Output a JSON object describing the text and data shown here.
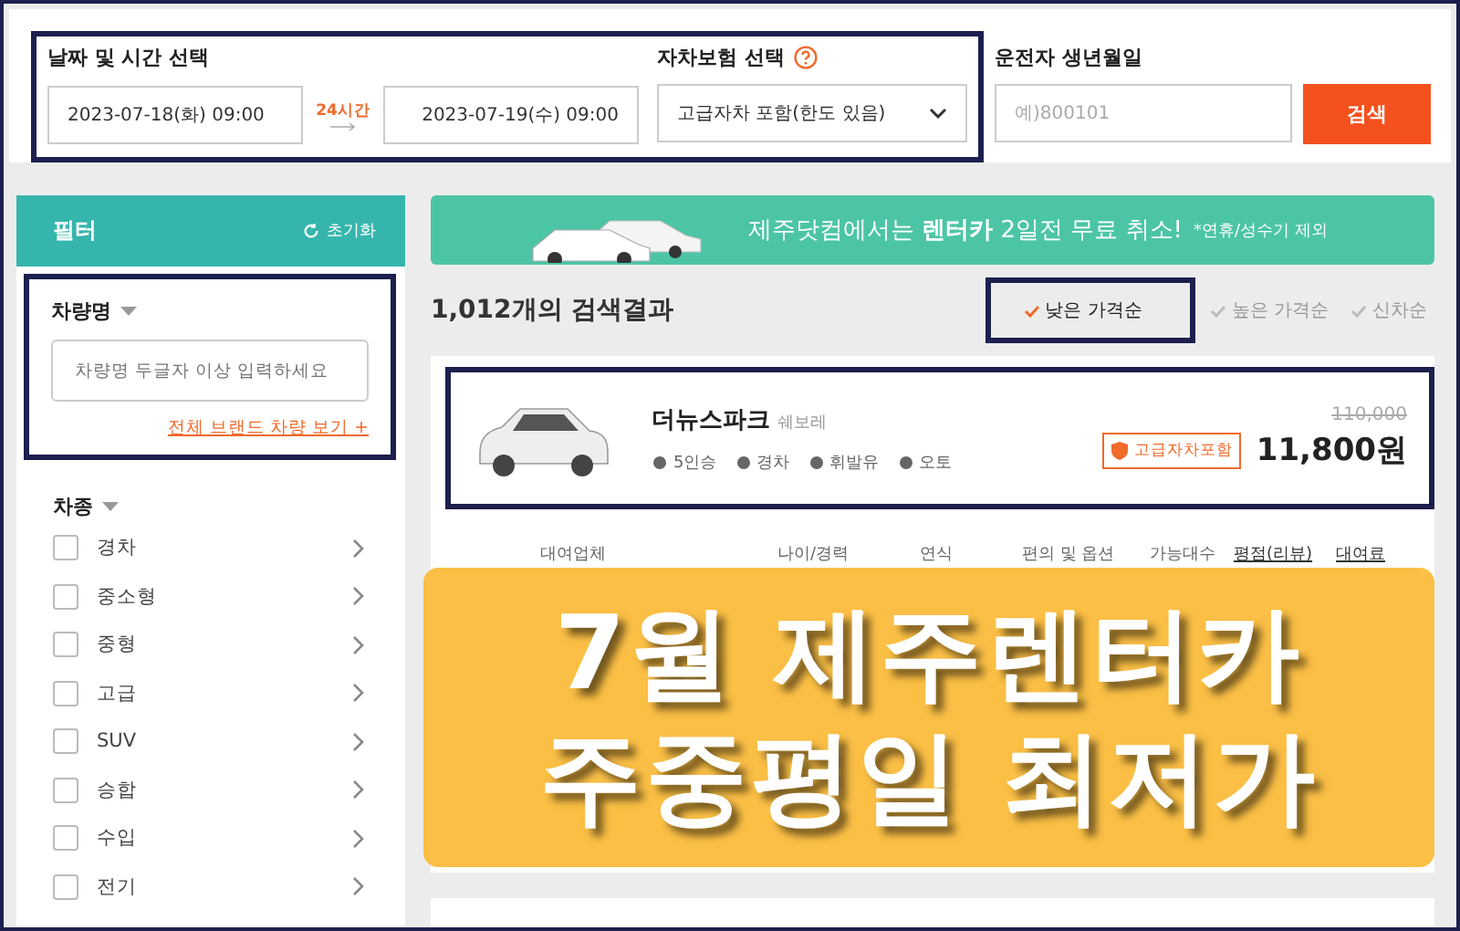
{
  "search_bar": {
    "date_label": "날짜 및 시간 선택",
    "pickup": "2023-07-18(화) 09:00",
    "duration": "24시간",
    "return": "2023-07-19(수) 09:00",
    "insurance_label": "자차보험 선택",
    "insurance_value": "고급자차 포함(한도 있음)",
    "birth_label": "운전자 생년월일",
    "birth_placeholder": "예)800101",
    "search_button": "검색"
  },
  "filter": {
    "title": "필터",
    "reset": "초기화",
    "car_name_label": "차량명",
    "car_name_placeholder": "차량명 두글자 이상 입력하세요",
    "all_brands_link": "전체 브랜드 차량 보기 +",
    "car_type_label": "차종",
    "car_types": [
      {
        "label": "경차",
        "checked": false
      },
      {
        "label": "중소형",
        "checked": false
      },
      {
        "label": "중형",
        "checked": false
      },
      {
        "label": "고급",
        "checked": false
      },
      {
        "label": "SUV",
        "checked": false
      },
      {
        "label": "승합",
        "checked": false
      },
      {
        "label": "수입",
        "checked": false
      },
      {
        "label": "전기",
        "checked": false
      }
    ]
  },
  "banner": {
    "text": "제주닷컴에서는 **렌터카** 2일전 무료 취소!",
    "note": "*연휴/성수기 제외"
  },
  "results": {
    "count": "1,012개의 검색결과",
    "sort_options": [
      {
        "label": "낮은 가격순",
        "selected": true
      },
      {
        "label": "높은 가격순",
        "selected": false
      },
      {
        "label": "신차순",
        "selected": false
      }
    ]
  },
  "car": {
    "name": "더뉴스파크",
    "brand": "쉐보레",
    "specs": [
      "5인승",
      "경차",
      "휘발유",
      "오토"
    ],
    "original_price": "110,000",
    "insurance_badge": "고급자차포함",
    "price": "11,800원"
  },
  "table": {
    "columns": [
      "대여업체",
      "나이/경력",
      "연식",
      "편의 및 옵션",
      "가능대수",
      "평점(리뷰)",
      "대여료"
    ]
  },
  "overlay": {
    "lines": [
      "7월 제주렌터카",
      "주중평일 최저가"
    ]
  }
}
